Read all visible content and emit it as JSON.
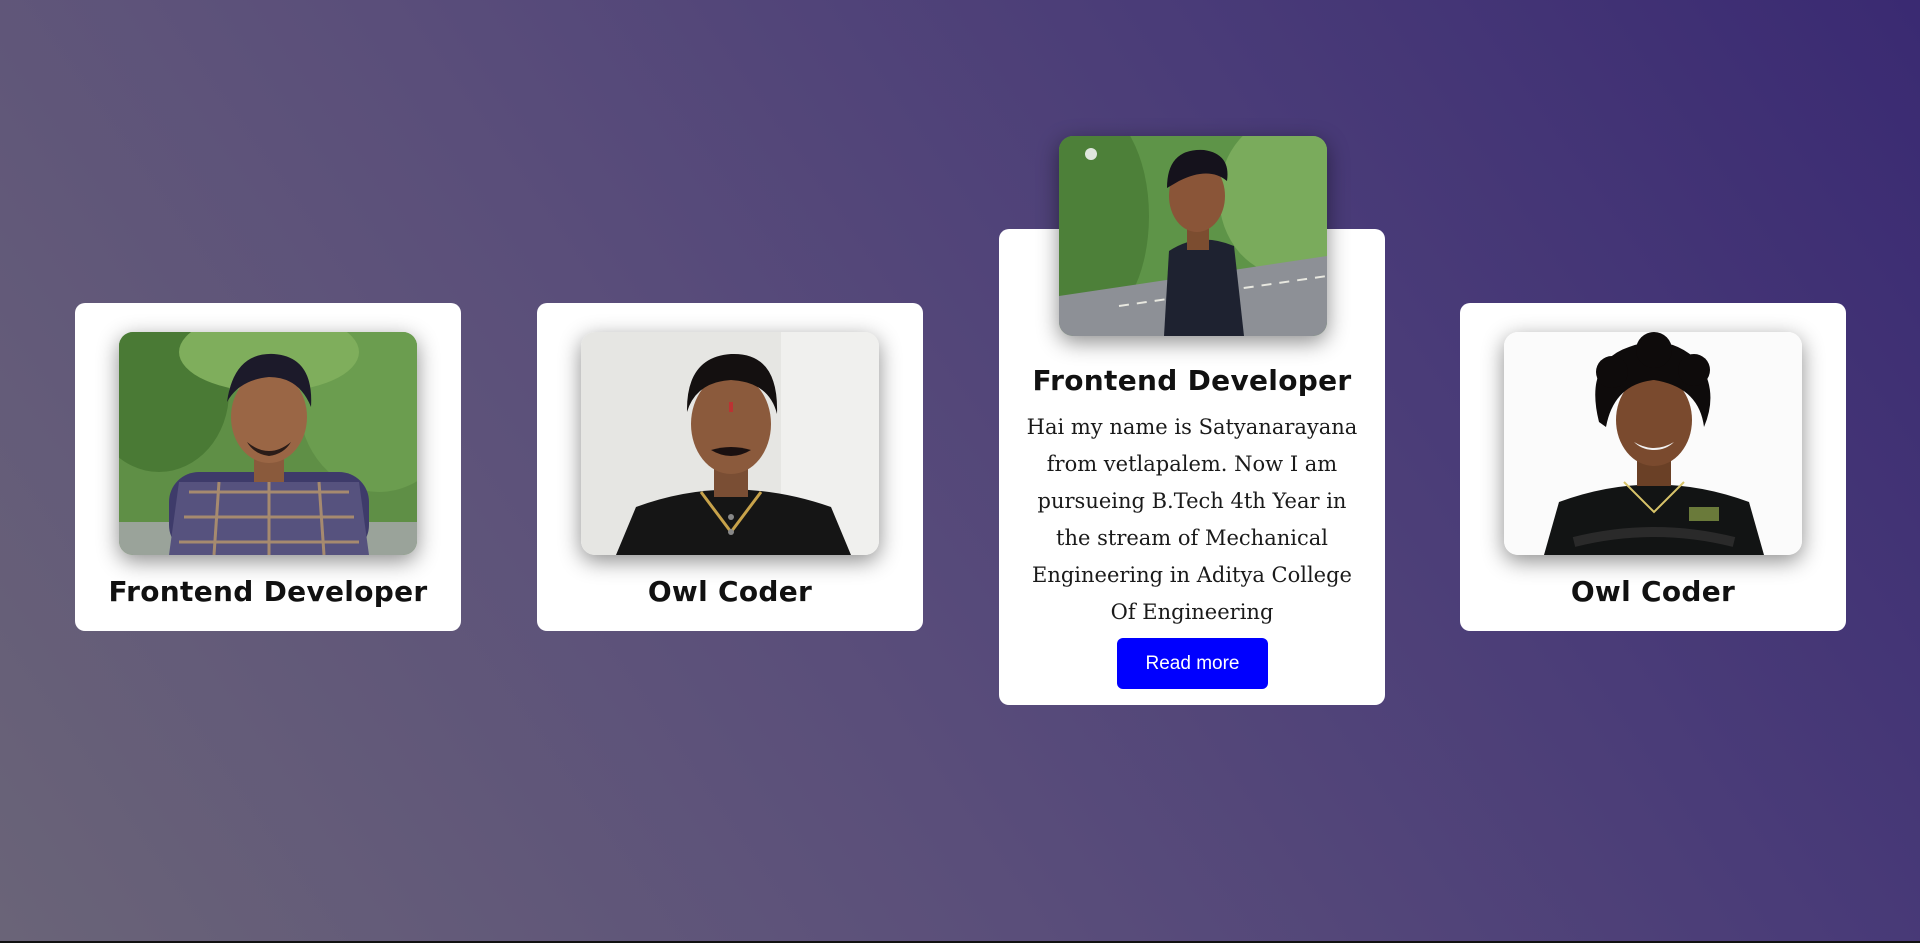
{
  "cards": [
    {
      "title": "Frontend Developer",
      "photo": "person-portrait-trees-checked-shirt"
    },
    {
      "title": "Owl Coder",
      "photo": "person-portrait-black-polo-light-wall"
    },
    {
      "title": "Frontend Developer",
      "photo": "person-side-profile-road-trees",
      "description": "Hai my name is Satyanarayana from vetlapalem. Now I am pursueing B.Tech 4th Year in the stream of Mechanical Engineering in Aditya College Of Engineering",
      "button_label": "Read more"
    },
    {
      "title": "Owl Coder",
      "photo": "person-portrait-curly-hair-white-bg"
    }
  ],
  "colors": {
    "background_start": "#3a2a72",
    "background_end": "#6a6478",
    "card": "#ffffff",
    "button": "#0000ff"
  }
}
